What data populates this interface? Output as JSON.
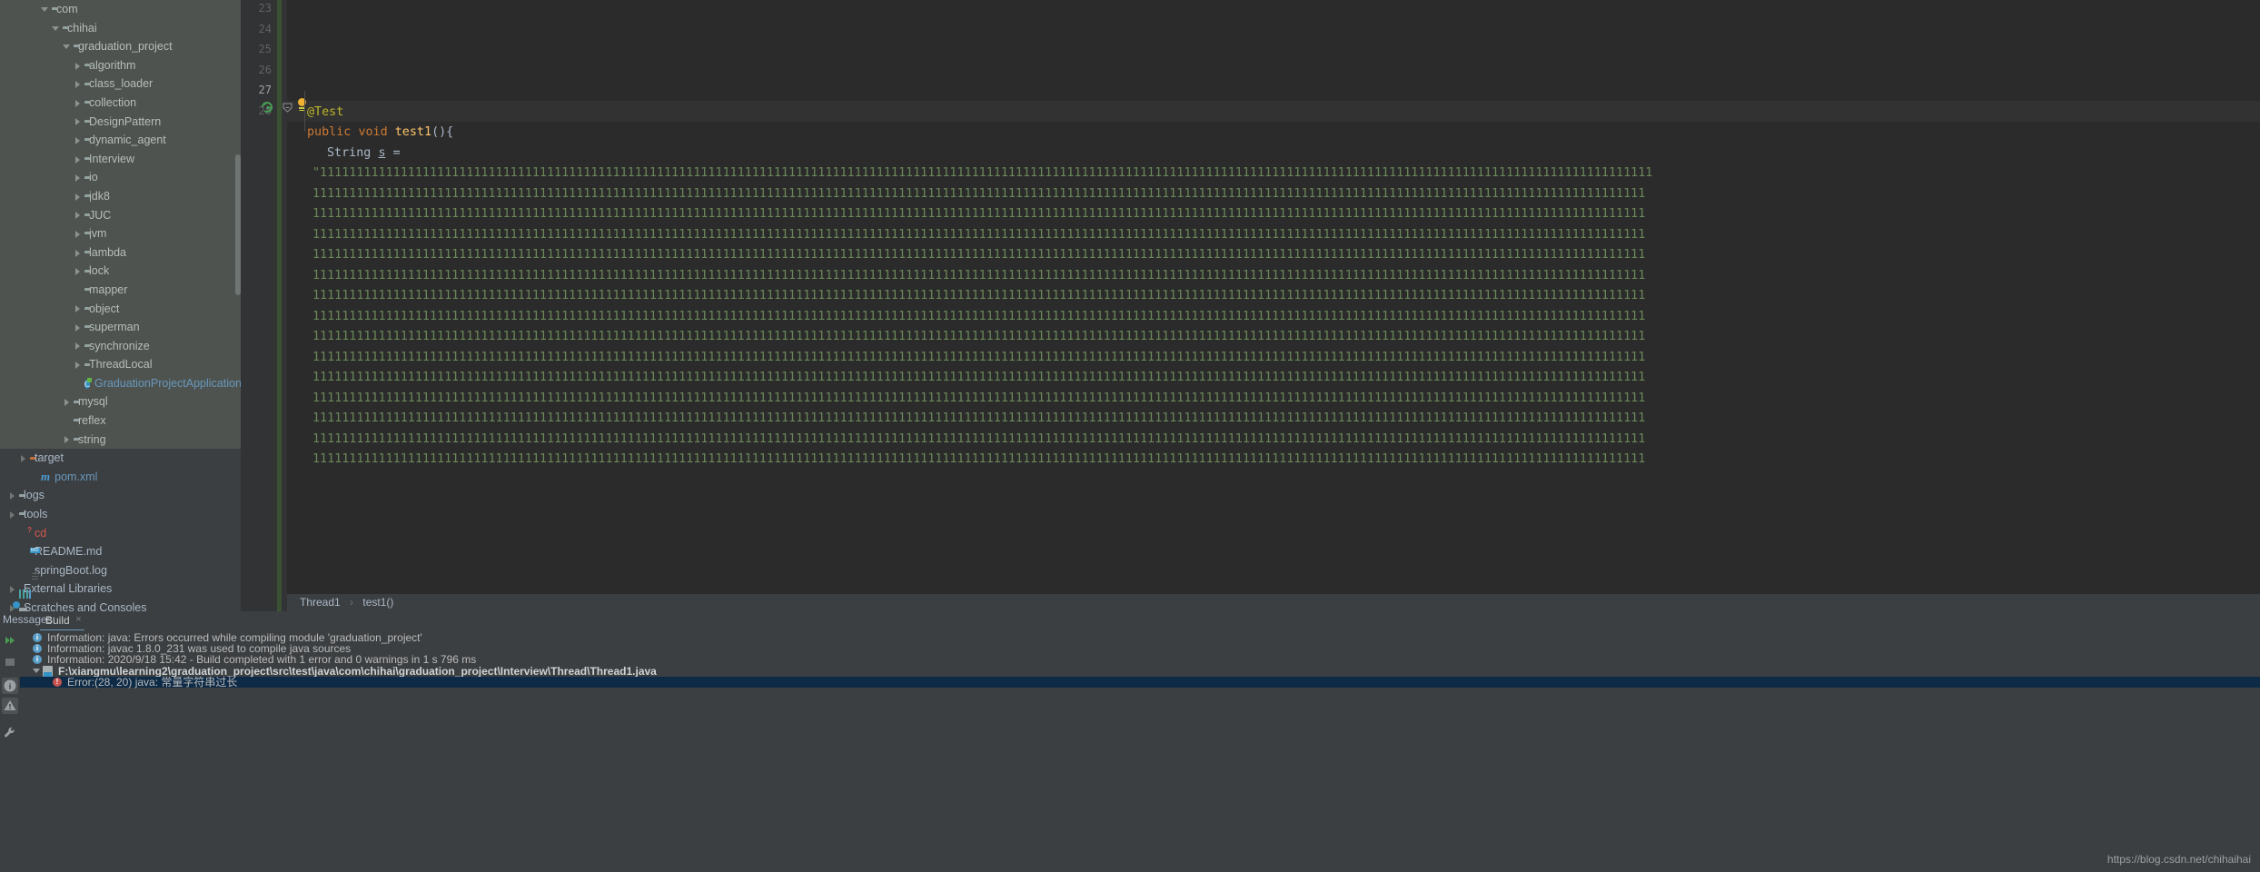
{
  "project_tree": [
    {
      "label": "com",
      "indent": 3,
      "arrow": "down",
      "icon": "folder",
      "style": "light"
    },
    {
      "label": "chihai",
      "indent": 4,
      "arrow": "down",
      "icon": "folder",
      "style": "light"
    },
    {
      "label": "graduation_project",
      "indent": 5,
      "arrow": "down",
      "icon": "folder",
      "style": "light"
    },
    {
      "label": "algorithm",
      "indent": 6,
      "arrow": "right",
      "icon": "folder",
      "style": "light"
    },
    {
      "label": "class_loader",
      "indent": 6,
      "arrow": "right",
      "icon": "folder",
      "style": "light"
    },
    {
      "label": "collection",
      "indent": 6,
      "arrow": "right",
      "icon": "folder",
      "style": "light"
    },
    {
      "label": "DesignPattern",
      "indent": 6,
      "arrow": "right",
      "icon": "folder",
      "style": "light"
    },
    {
      "label": "dynamic_agent",
      "indent": 6,
      "arrow": "right",
      "icon": "folder",
      "style": "light"
    },
    {
      "label": "Interview",
      "indent": 6,
      "arrow": "right",
      "icon": "folder",
      "style": "light"
    },
    {
      "label": "io",
      "indent": 6,
      "arrow": "right",
      "icon": "folder",
      "style": "light"
    },
    {
      "label": "jdk8",
      "indent": 6,
      "arrow": "right",
      "icon": "folder",
      "style": "light"
    },
    {
      "label": "JUC",
      "indent": 6,
      "arrow": "right",
      "icon": "folder",
      "style": "light"
    },
    {
      "label": "jvm",
      "indent": 6,
      "arrow": "right",
      "icon": "folder",
      "style": "light"
    },
    {
      "label": "lambda",
      "indent": 6,
      "arrow": "right",
      "icon": "folder",
      "style": "light"
    },
    {
      "label": "lock",
      "indent": 6,
      "arrow": "right",
      "icon": "folder",
      "style": "light"
    },
    {
      "label": "mapper",
      "indent": 6,
      "arrow": "none",
      "icon": "folder",
      "style": "light"
    },
    {
      "label": "object",
      "indent": 6,
      "arrow": "right",
      "icon": "folder",
      "style": "light"
    },
    {
      "label": "superman",
      "indent": 6,
      "arrow": "right",
      "icon": "folder",
      "style": "light"
    },
    {
      "label": "synchronize",
      "indent": 6,
      "arrow": "right",
      "icon": "folder",
      "style": "light"
    },
    {
      "label": "ThreadLocal",
      "indent": 6,
      "arrow": "right",
      "icon": "folder",
      "style": "light"
    },
    {
      "label": "GraduationProjectApplicationTests",
      "indent": 6,
      "arrow": "none",
      "icon": "class",
      "style": "light",
      "text_color": "blue"
    },
    {
      "label": "mysql",
      "indent": 5,
      "arrow": "right",
      "icon": "folder",
      "style": "light"
    },
    {
      "label": "reflex",
      "indent": 5,
      "arrow": "none",
      "icon": "folder",
      "style": "light"
    },
    {
      "label": "string",
      "indent": 5,
      "arrow": "right",
      "icon": "folder",
      "style": "light"
    },
    {
      "label": "target",
      "indent": 1,
      "arrow": "right",
      "icon": "folder-orange",
      "style": "dark"
    },
    {
      "label": "pom.xml",
      "indent": 2,
      "arrow": "none",
      "icon": "maven",
      "style": "dark",
      "text_color": "blue"
    },
    {
      "label": "logs",
      "indent": 0,
      "arrow": "right",
      "icon": "folder2",
      "style": "dark"
    },
    {
      "label": "tools",
      "indent": 0,
      "arrow": "right",
      "icon": "folder2",
      "style": "dark"
    },
    {
      "label": "cd",
      "indent": 1,
      "arrow": "none",
      "icon": "file-unknown",
      "style": "dark",
      "text_color": "cd"
    },
    {
      "label": "README.md",
      "indent": 1,
      "arrow": "none",
      "icon": "file-md",
      "style": "dark"
    },
    {
      "label": "springBoot.log",
      "indent": 1,
      "arrow": "none",
      "icon": "file-log",
      "style": "dark"
    },
    {
      "label": "External Libraries",
      "indent": 0,
      "arrow": "right-small",
      "icon": "lib",
      "style": "dark"
    },
    {
      "label": "Scratches and Consoles",
      "indent": 0,
      "arrow": "right-small",
      "icon": "scratch",
      "style": "dark"
    }
  ],
  "editor": {
    "line_numbers": [
      "23",
      "24",
      "25",
      "26",
      "27",
      "28"
    ],
    "current_line": "27",
    "code": {
      "annotation": "@Test",
      "kw_public": "public",
      "kw_void": "void",
      "method_name": "test1",
      "method_parens": "()",
      "brace": "{",
      "type_string": "String",
      "var_name": "s",
      "assign": "=",
      "string_open_quote": "\"",
      "string_fill_char": "1"
    },
    "breadcrumb": {
      "class": "Thread1",
      "separator": "›",
      "method": "test1()"
    }
  },
  "messages_panel": {
    "label": "Messages:",
    "tab": "Build",
    "close_glyph": "×",
    "rows": [
      {
        "type": "info",
        "text": "Information: java: Errors occurred while compiling module 'graduation_project'"
      },
      {
        "type": "info",
        "text": "Information: javac 1.8.0_231 was used to compile java sources"
      },
      {
        "type": "info",
        "text": "Information: 2020/9/18 15:42 - Build completed with 1 error and 0 warnings in 1 s 796 ms"
      },
      {
        "type": "file",
        "text": "F:\\xiangmu\\learning2\\graduation_project\\src\\test\\java\\com\\chihai\\graduation_project\\Interview\\Thread\\Thread1.java"
      },
      {
        "type": "error",
        "text": "Error:(28, 20)  java: 常量字符串过长"
      }
    ],
    "toolbar_icons": [
      "run-all-icon",
      "stop-icon",
      "info-filter-icon",
      "warning-filter-icon",
      "settings-wrench-icon"
    ]
  },
  "watermark": "https://blog.csdn.net/chihaihai",
  "colors": {
    "panel_bg": "#3c3f41",
    "tree_bg": "#4e5350",
    "editor_bg": "#2b2b2b",
    "gutter_bg": "#313335",
    "string_green": "#6a8759",
    "keyword_orange": "#cc7832",
    "method_yellow": "#ffc66d",
    "annotation_yellow": "#bbb529",
    "error_red": "#c75450",
    "accent_blue": "#6897bb",
    "selection_blue": "#0d2a46"
  }
}
